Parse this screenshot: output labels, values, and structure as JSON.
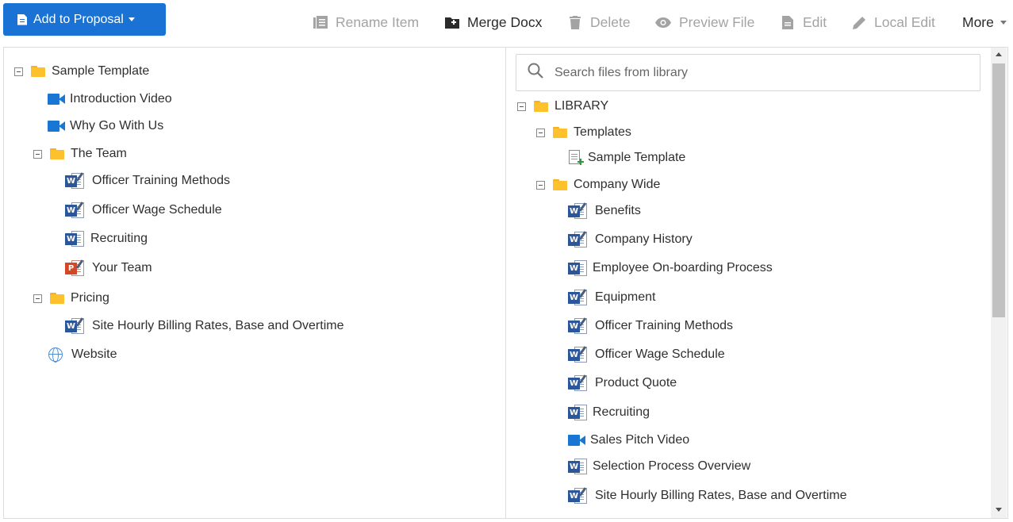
{
  "toolbar": {
    "add_label": "Add to Proposal",
    "rename": "Rename Item",
    "merge": "Merge Docx",
    "delete": "Delete",
    "preview": "Preview File",
    "edit": "Edit",
    "local_edit": "Local Edit",
    "more": "More"
  },
  "proposal_tree": {
    "root": "Sample Template",
    "intro_video": "Introduction Video",
    "why_go": "Why Go With Us",
    "team_folder": "The Team",
    "officer_training": "Officer Training Methods",
    "officer_wage": "Officer Wage Schedule",
    "recruiting": "Recruiting",
    "your_team": "Your Team",
    "pricing_folder": "Pricing",
    "site_hourly": "Site Hourly Billing Rates, Base and Overtime",
    "website": "Website"
  },
  "library": {
    "search_placeholder": "Search files from library",
    "root": "LIBRARY",
    "templates_folder": "Templates",
    "sample_template": "Sample Template",
    "company_folder": "Company Wide",
    "items": [
      "Benefits",
      "Company History",
      "Employee On-boarding Process",
      "Equipment",
      "Officer Training Methods",
      "Officer Wage Schedule",
      "Product Quote",
      "Recruiting",
      "Sales Pitch Video",
      "Selection Process Overview",
      "Site Hourly Billing Rates, Base and Overtime"
    ]
  },
  "colors": {
    "primary": "#1a73d4",
    "folder": "#fcc12d",
    "word": "#2b579a",
    "video": "#1976d2",
    "powerpoint": "#d24726"
  }
}
